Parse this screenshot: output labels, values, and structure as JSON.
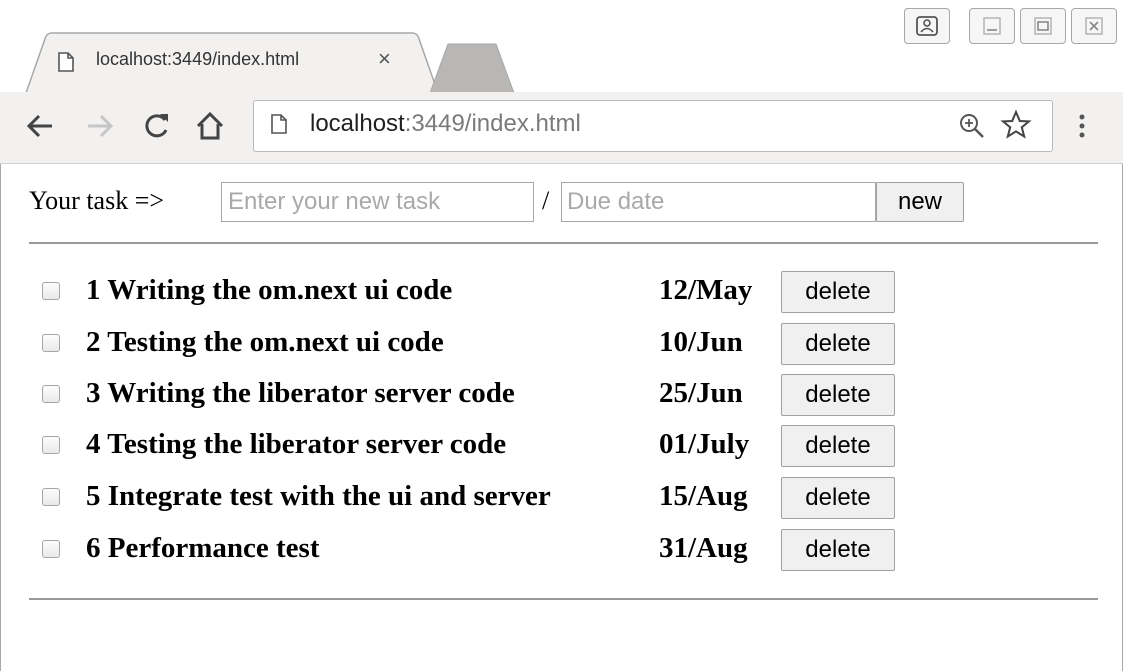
{
  "browser": {
    "tab_title": "localhost:3449/index.html",
    "tab_close_glyph": "×",
    "url_host": "localhost",
    "url_rest": ":3449/index.html",
    "icons": [
      "page-icon",
      "back-arrow-icon",
      "forward-arrow-icon",
      "reload-icon",
      "home-icon",
      "zoom-icon",
      "star-icon",
      "menu-icon",
      "user-icon",
      "minimize-icon",
      "maximize-icon",
      "close-icon"
    ]
  },
  "form": {
    "label": "Your task =>",
    "task_placeholder": "Enter your new task",
    "separator": "/",
    "due_placeholder": "Due date",
    "new_label": "new"
  },
  "tasks": [
    {
      "name": "1 Writing the om.next ui code",
      "due": "12/May",
      "delete_label": "delete"
    },
    {
      "name": "2 Testing the om.next ui code",
      "due": "10/Jun",
      "delete_label": "delete"
    },
    {
      "name": "3 Writing the liberator server code",
      "due": "25/Jun",
      "delete_label": "delete"
    },
    {
      "name": "4 Testing the liberator server code",
      "due": "01/July",
      "delete_label": "delete"
    },
    {
      "name": "5 Integrate test with the ui and server",
      "due": "15/Aug",
      "delete_label": "delete"
    },
    {
      "name": "6 Performance test",
      "due": "31/Aug",
      "delete_label": "delete"
    }
  ]
}
